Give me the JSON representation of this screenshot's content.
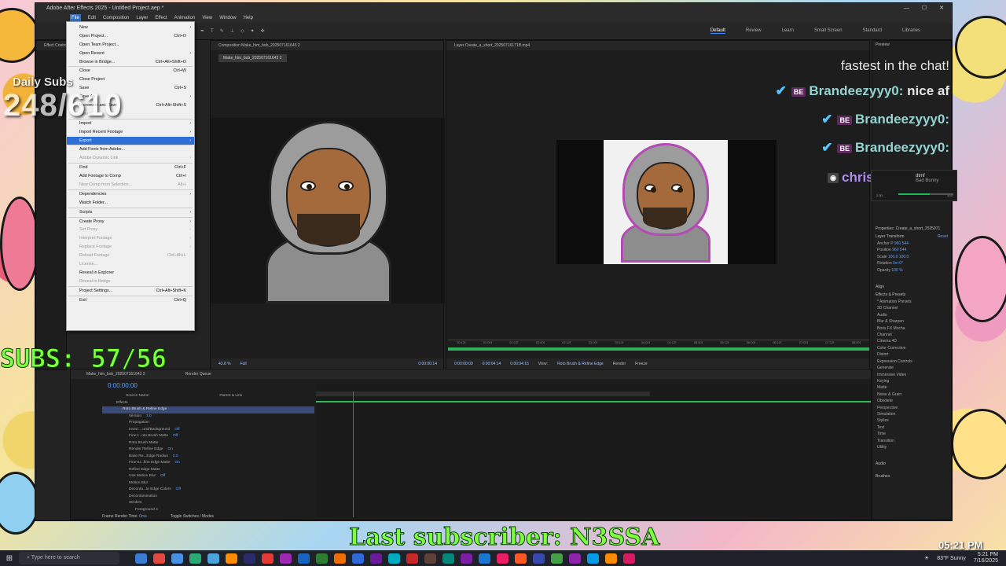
{
  "ae_window": {
    "title": "Adobe After Effects 2025 - Untitled Project.aep *",
    "menu": [
      "File",
      "Edit",
      "Composition",
      "Layer",
      "Effect",
      "Animation",
      "View",
      "Window",
      "Help"
    ],
    "workspaces": [
      "Default",
      "Review",
      "Learn",
      "Small Screen",
      "Standard",
      "Libraries"
    ],
    "active_workspace": "Default"
  },
  "file_menu": {
    "items": [
      {
        "label": "New",
        "shortcut": "",
        "submenu": true,
        "disabled": false
      },
      {
        "label": "Open Project...",
        "shortcut": "Ctrl+O",
        "submenu": false,
        "disabled": false
      },
      {
        "label": "Open Team Project...",
        "shortcut": "",
        "submenu": false,
        "disabled": false
      },
      {
        "label": "Open Recent",
        "shortcut": "",
        "submenu": true,
        "disabled": false
      },
      {
        "label": "Browse in Bridge...",
        "shortcut": "Ctrl+Alt+Shift+O",
        "submenu": false,
        "disabled": false
      },
      {
        "sep": true
      },
      {
        "label": "Close",
        "shortcut": "Ctrl+W",
        "submenu": false,
        "disabled": false
      },
      {
        "label": "Close Project",
        "shortcut": "",
        "submenu": false,
        "disabled": false
      },
      {
        "label": "Save",
        "shortcut": "Ctrl+S",
        "submenu": false,
        "disabled": false
      },
      {
        "label": "Save As",
        "shortcut": "",
        "submenu": true,
        "disabled": false
      },
      {
        "label": "Increment and Save",
        "shortcut": "Ctrl+Alt+Shift+S",
        "submenu": false,
        "disabled": false
      },
      {
        "label": "Revert",
        "shortcut": "",
        "submenu": false,
        "disabled": true
      },
      {
        "sep": true
      },
      {
        "label": "Import",
        "shortcut": "",
        "submenu": true,
        "disabled": false
      },
      {
        "label": "Import Recent Footage",
        "shortcut": "",
        "submenu": true,
        "disabled": false
      },
      {
        "label": "Export",
        "shortcut": "",
        "submenu": true,
        "disabled": false,
        "highlight": true
      },
      {
        "sep": true
      },
      {
        "label": "Add Fonts from Adobe...",
        "shortcut": "",
        "submenu": false,
        "disabled": false
      },
      {
        "label": "Adobe Dynamic Link",
        "shortcut": "",
        "submenu": true,
        "disabled": true
      },
      {
        "sep": true
      },
      {
        "label": "Find",
        "shortcut": "Ctrl+F",
        "submenu": false,
        "disabled": false
      },
      {
        "label": "Add Footage to Comp",
        "shortcut": "Ctrl+/",
        "submenu": false,
        "disabled": false
      },
      {
        "label": "New Comp from Selection...",
        "shortcut": "Alt+\\",
        "submenu": false,
        "disabled": true
      },
      {
        "sep": true
      },
      {
        "label": "Dependencies",
        "shortcut": "",
        "submenu": true,
        "disabled": false
      },
      {
        "label": "Watch Folder...",
        "shortcut": "",
        "submenu": false,
        "disabled": false
      },
      {
        "sep": true
      },
      {
        "label": "Scripts",
        "shortcut": "",
        "submenu": true,
        "disabled": false
      },
      {
        "sep": true
      },
      {
        "label": "Create Proxy",
        "shortcut": "",
        "submenu": true,
        "disabled": false
      },
      {
        "label": "Set Proxy",
        "shortcut": "",
        "submenu": true,
        "disabled": true
      },
      {
        "label": "Interpret Footage",
        "shortcut": "",
        "submenu": true,
        "disabled": true
      },
      {
        "label": "Replace Footage",
        "shortcut": "",
        "submenu": true,
        "disabled": true
      },
      {
        "label": "Reload Footage",
        "shortcut": "Ctrl+Alt+L",
        "submenu": false,
        "disabled": true
      },
      {
        "label": "License...",
        "shortcut": "",
        "submenu": false,
        "disabled": true
      },
      {
        "label": "Reveal in Explorer",
        "shortcut": "",
        "submenu": false,
        "disabled": false
      },
      {
        "label": "Reveal in Bridge",
        "shortcut": "",
        "submenu": false,
        "disabled": true
      },
      {
        "sep": true
      },
      {
        "label": "Project Settings...",
        "shortcut": "Ctrl+Alt+Shift+K",
        "submenu": false,
        "disabled": false
      },
      {
        "sep": true
      },
      {
        "label": "Exit",
        "shortcut": "Ctrl+Q",
        "submenu": false,
        "disabled": false
      }
    ]
  },
  "comp_left": {
    "header": "Composition Make_him_bob_202507161643 2",
    "sub_tab": "Make_him_bob_202507161643 2",
    "zoom": "43.8 %",
    "resolution": "Full",
    "time": "0:00:00:14"
  },
  "comp_right": {
    "header": "Layer Create_a_short_20250716171B.mp4",
    "time_a": "0:00:00:00",
    "time_b": "0:00:04:14",
    "time_c": "0:00:04:15",
    "view_label": "View:",
    "view_value": "Roto Brush & Refine Edge",
    "render": "Render",
    "freeze": "Freeze",
    "ruler": [
      "00:12f",
      "01:00f",
      "01:12f",
      "02:00f",
      "02:12f",
      "03:00f",
      "03:12f",
      "04:00f",
      "04:12f",
      "05:00f",
      "05:12f",
      "06:00f",
      "06:12f",
      "07:00f",
      "07:12f",
      "08:00f"
    ]
  },
  "right_panel": {
    "preview": "Preview",
    "properties_title": "Properties: Create_a_short_2025071",
    "layer_transform": "Layer Transform",
    "reset": "Reset",
    "props": [
      {
        "label": "Anchor P",
        "value": "960    544"
      },
      {
        "label": "Position",
        "value": "960    544"
      },
      {
        "label": "Scale",
        "value": "100.0    100.0"
      },
      {
        "label": "Rotation",
        "value": "0x+0°"
      },
      {
        "label": "Opacity",
        "value": "100 %"
      }
    ],
    "align": "Align",
    "effects_title": "Effects & Presets",
    "effects": [
      "* Animation Presets",
      "3D Channel",
      "Audio",
      "Blur & Sharpen",
      "Boris FX Mocha",
      "Channel",
      "Cinema 4D",
      "Color Correction",
      "Distort",
      "Expression Controls",
      "Generate",
      "Immersive Video",
      "Keying",
      "Matte",
      "Noise & Grain",
      "Obsolete",
      "Perspective",
      "Simulation",
      "Stylize",
      "Text",
      "Time",
      "Transition",
      "Utility"
    ],
    "audio": "Audio",
    "brushes": "Brushes"
  },
  "timeline": {
    "tab": "Make_him_bob_202507161643 2",
    "render_queue": "Render Queue",
    "time": "0:00:00:00",
    "col_source": "Source Name",
    "col_parent": "Parent & Link",
    "rows": [
      {
        "label": "Effects",
        "value": "",
        "indent": 1,
        "sel": false
      },
      {
        "label": "Roto Brush & Refine Edge",
        "value": "",
        "indent": 2,
        "sel": true
      },
      {
        "label": "Version",
        "value": "3.0",
        "indent": 3,
        "sel": false
      },
      {
        "label": "Propagation",
        "value": "",
        "indent": 3,
        "sel": false
      },
      {
        "label": "Invert ...und/Background",
        "value": "Off",
        "indent": 3,
        "sel": false
      },
      {
        "label": "Fine-t...oto Brush Matte",
        "value": "Off",
        "indent": 3,
        "sel": false
      },
      {
        "label": "Roto Brush Matte",
        "value": "",
        "indent": 3,
        "sel": false
      },
      {
        "label": "Render Refine Edge",
        "value": "On",
        "indent": 3,
        "sel": false
      },
      {
        "label": "Base Re...Edge Radius",
        "value": "0.0",
        "indent": 3,
        "sel": false
      },
      {
        "label": "Fine-tu...fine Edge Matte",
        "value": "On",
        "indent": 3,
        "sel": false
      },
      {
        "label": "Refine Edge Matte",
        "value": "",
        "indent": 3,
        "sel": false
      },
      {
        "label": "Use Motion Blur",
        "value": "Off",
        "indent": 3,
        "sel": false
      },
      {
        "label": "Motion Blur",
        "value": "",
        "indent": 3,
        "sel": false
      },
      {
        "label": "Deconta...te Edge Colors",
        "value": "Off",
        "indent": 3,
        "sel": false
      },
      {
        "label": "Decontamination",
        "value": "",
        "indent": 3,
        "sel": false
      },
      {
        "label": "Strokes",
        "value": "",
        "indent": 3,
        "sel": false
      },
      {
        "label": "Foreground 4",
        "value": "",
        "indent": 4,
        "sel": false
      }
    ],
    "ruler": [
      "00:12f",
      "01:00f",
      "01:12f",
      "02:00f",
      "02:12f",
      "03:00f",
      "03:12f",
      "04:00f",
      "04:12f",
      "05:00f",
      "05:12f",
      "06:00f",
      "06:12f",
      "07:00f",
      "07:12f",
      "08:00f"
    ],
    "frame_render": "Frame Render Time:",
    "frame_render_val": "0ms",
    "toggle": "Toggle Switches / Modes"
  },
  "overlays": {
    "daily_subs_label": "Daily Subs",
    "daily_subs_value": "248/610",
    "subs_counter": "SUBS: 57/56",
    "last_subscriber": "Last subscriber: N3SSA",
    "chat_partial": "fastest in the chat!",
    "chat": [
      {
        "user": "Brandeezyyy0:",
        "msg": " nice af",
        "badge": "BE"
      },
      {
        "user": "Brandeezyyy0:",
        "msg": "",
        "badge": "BE"
      },
      {
        "user": "Brandeezyyy0:",
        "msg": "",
        "badge": "BE"
      }
    ],
    "chat_last_user": "christian_dior01:",
    "mini_player_title": "dtmf",
    "mini_player_artist": "Bad Bunny",
    "mini_time_a": "2:30",
    "mini_time_b": "3:57",
    "overlay_clock": "05:21 PM"
  },
  "taskbar": {
    "search_placeholder": "Type here to search",
    "weather": "83°F Sunny",
    "time": "5:21 PM",
    "date": "7/16/2025",
    "app_colors": [
      "#3a7bd5",
      "#e24a3b",
      "#4a90e2",
      "#2aa876",
      "#4ca3d9",
      "#ff8c00",
      "#2b2b6b",
      "#e53935",
      "#9c27b0",
      "#1565c0",
      "#2e7d32",
      "#ef6c00",
      "#2d6ad6",
      "#6a1b9a",
      "#00acc1",
      "#c62828",
      "#5d4037",
      "#00897b",
      "#7b1fa2",
      "#1976d2",
      "#e91e63",
      "#ff5722",
      "#3949ab",
      "#43a047",
      "#8e24aa",
      "#039be5",
      "#fb8c00",
      "#d81b60"
    ]
  }
}
